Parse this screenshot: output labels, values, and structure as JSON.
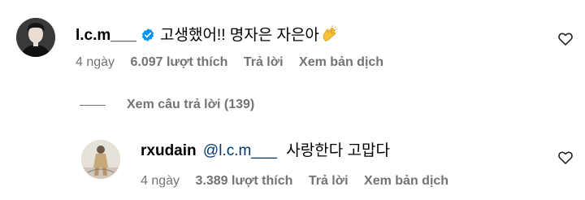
{
  "comments": [
    {
      "username": "l.c.m___",
      "verified": true,
      "text": "고생했어!! 명자은 자은아",
      "emoji": "clapping-hands",
      "time": "4 ngày",
      "likes": "6.097 lượt thích",
      "reply_label": "Trả lời",
      "translate_label": "Xem bản dịch"
    },
    {
      "username": "rxudain",
      "mention": "@l.c.m___",
      "text": "사랑한다 고맙다",
      "time": "4 ngày",
      "likes": "3.389 lượt thích",
      "reply_label": "Trả lời",
      "translate_label": "Xem bản dịch"
    }
  ],
  "view_replies": "Xem câu trả lời (139)",
  "colors": {
    "text": "#000000",
    "muted": "#737373",
    "mention": "#00376b",
    "verified": "#0095f6"
  }
}
